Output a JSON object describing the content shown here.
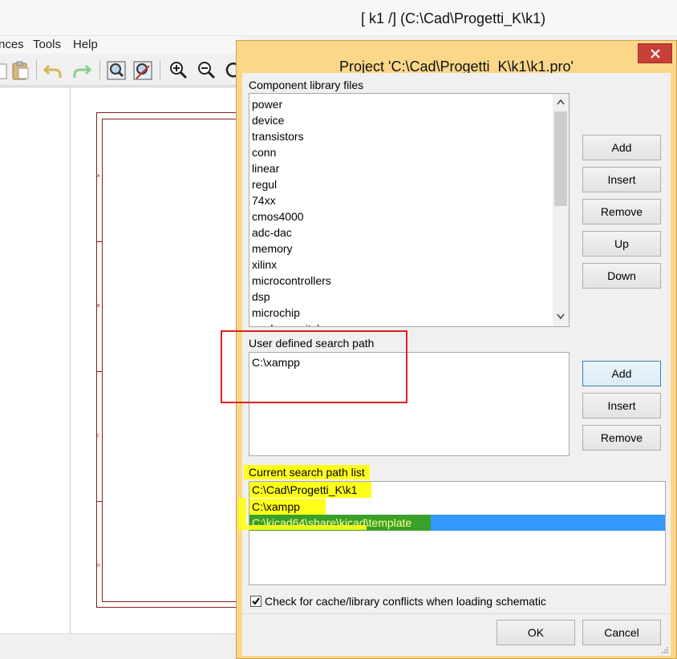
{
  "main_window": {
    "title": "[ k1 /] (C:\\Cad\\Progetti_K\\k1)",
    "menu": [
      "nces",
      "Tools",
      "Help"
    ],
    "toolbar_icons": [
      "paste-icon",
      "undo-icon",
      "redo-icon",
      "zoom-page-icon",
      "zoom-edit-icon",
      "zoom-in-icon",
      "zoom-out-icon",
      "zoom-redraw-icon"
    ],
    "sheet_row_labels": [
      "A",
      "B",
      "C",
      "D"
    ]
  },
  "dialog": {
    "title": "Project 'C:\\Cad\\Progetti_K\\k1\\k1.pro'",
    "component_libraries": {
      "label": "Component library files",
      "items": [
        "power",
        "device",
        "transistors",
        "conn",
        "linear",
        "regul",
        "74xx",
        "cmos4000",
        "adc-dac",
        "memory",
        "xilinx",
        "microcontrollers",
        "dsp",
        "microchip",
        "analog_switches"
      ],
      "buttons": {
        "add": "Add",
        "insert": "Insert",
        "remove": "Remove",
        "up": "Up",
        "down": "Down"
      }
    },
    "user_search_path": {
      "label": "User defined search path",
      "items": [
        "C:\\xampp"
      ],
      "buttons": {
        "add": "Add",
        "insert": "Insert",
        "remove": "Remove"
      }
    },
    "current_search_path": {
      "label": "Current search path list",
      "items": [
        "C:\\Cad\\Progetti_K\\k1",
        "C:\\xampp",
        "C:\\kicad64\\share\\kicad\\template"
      ],
      "selected_index": 2
    },
    "checkbox": {
      "label": "Check for cache/library conflicts when loading schematic",
      "checked": true
    },
    "footer": {
      "ok": "OK",
      "cancel": "Cancel"
    }
  },
  "colors": {
    "dialog_frame": "#fbd78a",
    "close_button": "#c7403a",
    "annotation_box": "#e02020",
    "highlight_yellow": "#ffff1a",
    "selection_blue": "#3399ff",
    "sheet_border": "#8b1c1c"
  }
}
